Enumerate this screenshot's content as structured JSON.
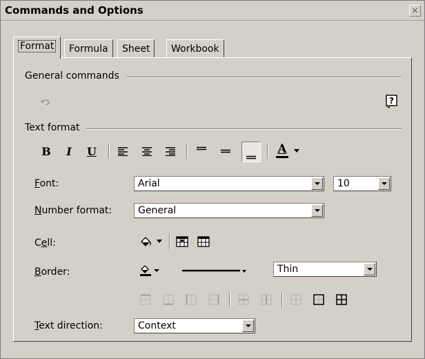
{
  "window": {
    "title": "Commands and Options",
    "close_glyph": "×"
  },
  "tabs": [
    {
      "label": "Format",
      "active": true
    },
    {
      "label": "Formula",
      "active": false
    },
    {
      "label": "Sheet",
      "active": false
    },
    {
      "label": "Workbook",
      "active": false
    }
  ],
  "general": {
    "label": "General commands",
    "undo_icon": "undo-icon",
    "help_icon": "help-icon"
  },
  "text_format": {
    "label": "Text format",
    "bold": "B",
    "italic": "I",
    "underline": "U",
    "font_color_glyph": "A"
  },
  "font": {
    "label_mnemonic": "F",
    "label_rest": "ont:",
    "value": "Arial",
    "size": "10"
  },
  "number_format": {
    "label_mnemonic": "N",
    "label_rest": "umber format:",
    "value": "General"
  },
  "cell": {
    "label_pre": "C",
    "label_mnemonic": "e",
    "label_rest": "ll:"
  },
  "border": {
    "label_mnemonic": "B",
    "label_rest": "order:",
    "weight": "Thin"
  },
  "text_direction": {
    "label_mnemonic": "T",
    "label_rest": "ext direction:",
    "value": "Context"
  }
}
